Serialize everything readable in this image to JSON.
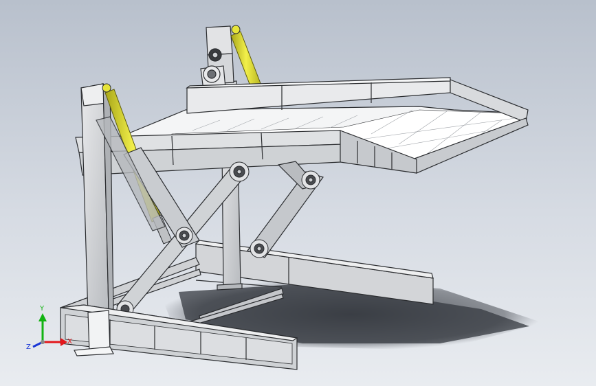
{
  "colors": {
    "background_top": "#b8c0cc",
    "background_bottom": "#e9ecf0",
    "steel": "#d9dbde",
    "steel_dark": "#8e9196",
    "edge": "#2b2d30",
    "cylinder": "#e6e43a",
    "cylinder_dark": "#a9a719",
    "shadow": "#3b3e44"
  },
  "triad": {
    "x_label": "X",
    "y_label": "Y",
    "z_label": "Z",
    "x_color": "#e3161b",
    "y_color": "#12b312",
    "z_color": "#1a37d6"
  }
}
